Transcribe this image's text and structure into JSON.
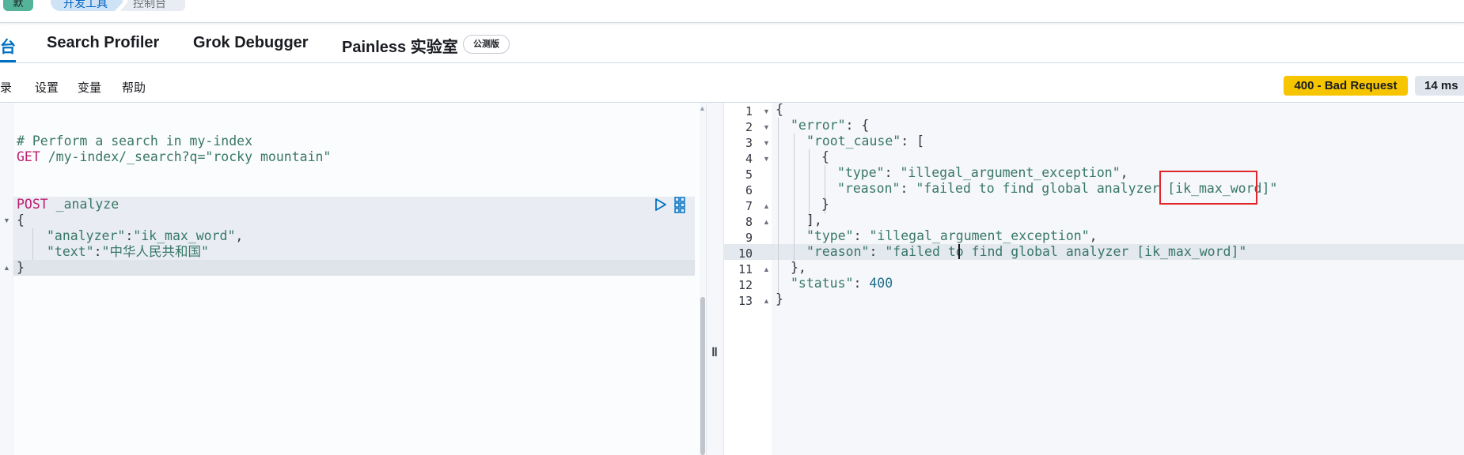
{
  "header": {
    "space_initial": "默",
    "breadcrumbs": [
      "开发工具",
      "控制台"
    ]
  },
  "tabs": [
    {
      "label": "台",
      "active": true
    },
    {
      "label": "Search Profiler",
      "active": false
    },
    {
      "label": "Grok Debugger",
      "active": false
    },
    {
      "label": "Painless 实验室",
      "active": false
    }
  ],
  "painless_badge": "公测版",
  "toolbar": {
    "links": [
      "记录",
      "设置",
      "变量",
      "帮助"
    ],
    "status": "400 - Bad Request",
    "time": "14 ms"
  },
  "request": {
    "comment": "# Perform a search in my-index",
    "get_method": "GET",
    "get_url": " /my-index/_search?q=\"rocky mountain\"",
    "post_method": "POST",
    "post_url": " _analyze",
    "open_brace": "{",
    "analyzer_key": "\"analyzer\"",
    "analyzer_val": "\"ik_max_word\"",
    "text_key": "\"text\"",
    "text_val": "\"中华人民共和国\"",
    "close_brace": "}"
  },
  "response": {
    "line_numbers": [
      "1",
      "2",
      "3",
      "4",
      "5",
      "6",
      "7",
      "8",
      "9",
      "10",
      "11",
      "12",
      "13"
    ],
    "l1": "{",
    "l2_key": "\"error\"",
    "l2_rest": ": {",
    "l3_key": "\"root_cause\"",
    "l3_rest": ": [",
    "l4": "{",
    "l5_key": "\"type\"",
    "l5_val": "\"illegal_argument_exception\"",
    "l6_key": "\"reason\"",
    "l6_val": "\"failed to find global analyzer [ik_max_word]\"",
    "l7": "}",
    "l8": "],",
    "l9_key": "\"type\"",
    "l9_val": "\"illegal_argument_exception\"",
    "l10_key": "\"reason\"",
    "l10_val": "\"failed to find global analyzer [ik_max_word]\"",
    "l11": "},",
    "l12_key": "\"status\"",
    "l12_val": "400",
    "l13": "}"
  }
}
